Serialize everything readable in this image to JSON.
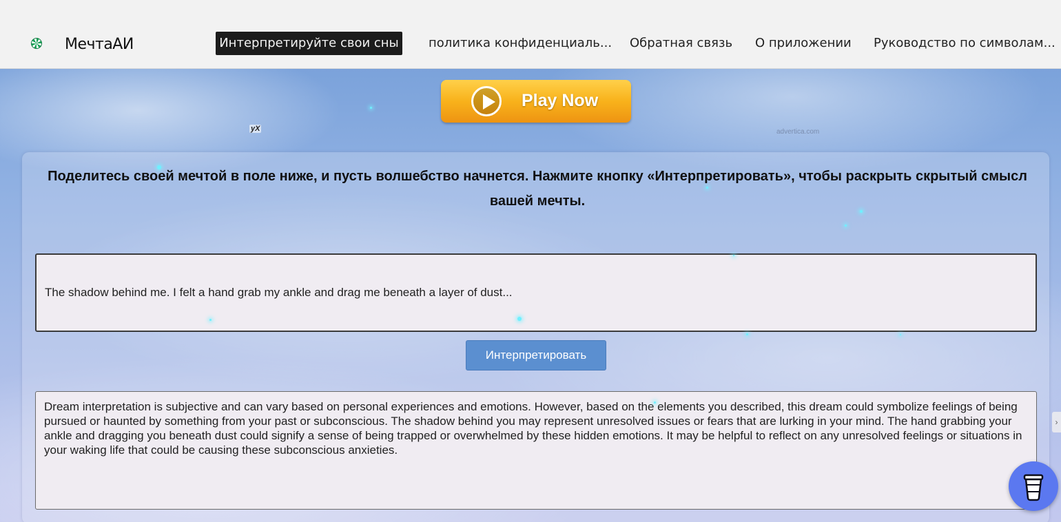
{
  "header": {
    "brand": "МечтаАИ",
    "nav": [
      {
        "label": "Интерпретируйте свои сны",
        "active": true
      },
      {
        "label": "политика конфиденциаль..."
      },
      {
        "label": "Обратная связь"
      },
      {
        "label": "О приложении"
      },
      {
        "label": "Руководство по символам..."
      }
    ]
  },
  "ad": {
    "button_label": "Play Now",
    "badge": "yX",
    "source": "advertica.com"
  },
  "main": {
    "intro": "Поделитесь своей мечтой в поле ниже, и пусть волшебство начнется. Нажмите кнопку «Интерпретировать», чтобы раскрыть скрытый смысл вашей мечты.",
    "dream_input_value": "The shadow behind me. I felt a hand grab my ankle and drag me beneath a layer of dust...",
    "interpret_label": "Интерпретировать",
    "result": "Dream interpretation is subjective and can vary based on personal experiences and emotions. However, based on the elements you described, this dream could symbolize feelings of being pursued or haunted by something from your past or subconscious. The shadow behind you may represent unresolved issues or fears that are lurking in your mind. The hand grabbing your ankle and dragging you beneath dust could signify a sense of being trapped or overwhelmed by these hidden emotions. It may be helpful to reflect on any unresolved feelings or situations in your waking life that could be causing these subconscious anxieties."
  },
  "icons": {
    "logo": "spinner-logo-icon",
    "coffee": "coffee-cup-icon",
    "play": "play-icon",
    "scroll": "chevron-right-icon"
  },
  "colors": {
    "header_bg": "#f2f2f2",
    "nav_active_bg": "#1c1c1c",
    "interpret_button": "#5b8fd0",
    "coffee_button": "#5b78f0",
    "ad_button": "#f8b21b"
  }
}
